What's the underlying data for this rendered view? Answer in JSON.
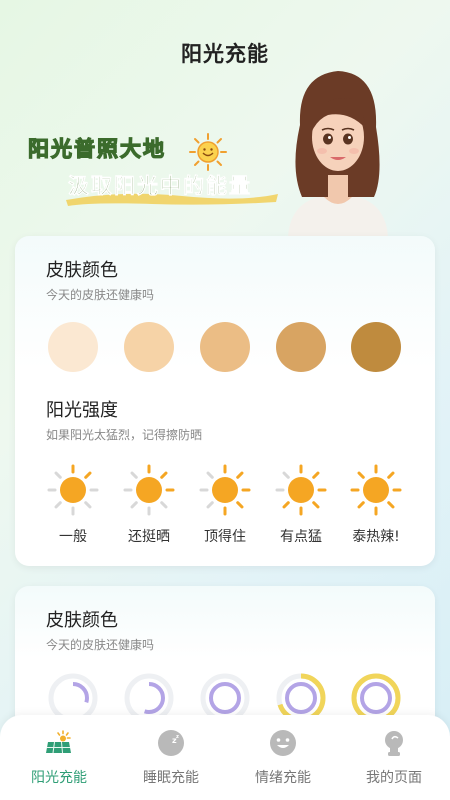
{
  "header": {
    "title": "阳光充能"
  },
  "banner": {
    "slogan_line1": "阳光普照大地",
    "slogan_line2": "汲取阳光中的能量"
  },
  "skin_section": {
    "title": "皮肤颜色",
    "subtitle": "今天的皮肤还健康吗",
    "swatches": [
      "#fbe8d2",
      "#f6d3a7",
      "#ebbd85",
      "#d8a462",
      "#bf8b3e"
    ]
  },
  "sun_section": {
    "title": "阳光强度",
    "subtitle": "如果阳光太猛烈，记得擦防晒",
    "levels": [
      {
        "label": "一般"
      },
      {
        "label": "还挺晒"
      },
      {
        "label": "顶得住"
      },
      {
        "label": "有点猛"
      },
      {
        "label": "泰热辣!"
      }
    ],
    "sun_color": "#f5a623",
    "ray_active": "#f5a623",
    "ray_inactive": "#d8d8d8"
  },
  "skin_section2": {
    "title": "皮肤颜色",
    "subtitle": "今天的皮肤还健康吗",
    "ring_color": "#b3a4e6",
    "ring_outer": "#f1d55a"
  },
  "tabbar": {
    "tabs": [
      {
        "label": "阳光充能",
        "icon": "solar-panel-icon",
        "active": true
      },
      {
        "label": "睡眠充能",
        "icon": "moon-icon",
        "active": false
      },
      {
        "label": "情绪充能",
        "icon": "smiley-icon",
        "active": false
      },
      {
        "label": "我的页面",
        "icon": "profile-icon",
        "active": false
      }
    ],
    "active_color": "#2f9e76"
  }
}
